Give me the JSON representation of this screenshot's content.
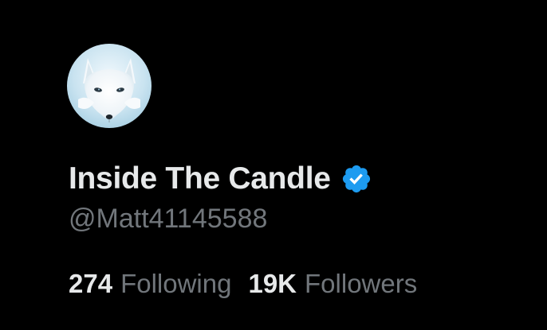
{
  "profile": {
    "avatar_icon": "white-fox-avatar",
    "display_name": "Inside The Candle",
    "verified_icon": "verified-badge-icon",
    "handle": "@Matt41145588"
  },
  "stats": {
    "following_count": "274",
    "following_label": "Following",
    "followers_count": "19K",
    "followers_label": "Followers"
  },
  "colors": {
    "background": "#000000",
    "name_text": "#e7e9ea",
    "secondary_text": "#71767b",
    "verified_blue": "#1d9bf0"
  }
}
